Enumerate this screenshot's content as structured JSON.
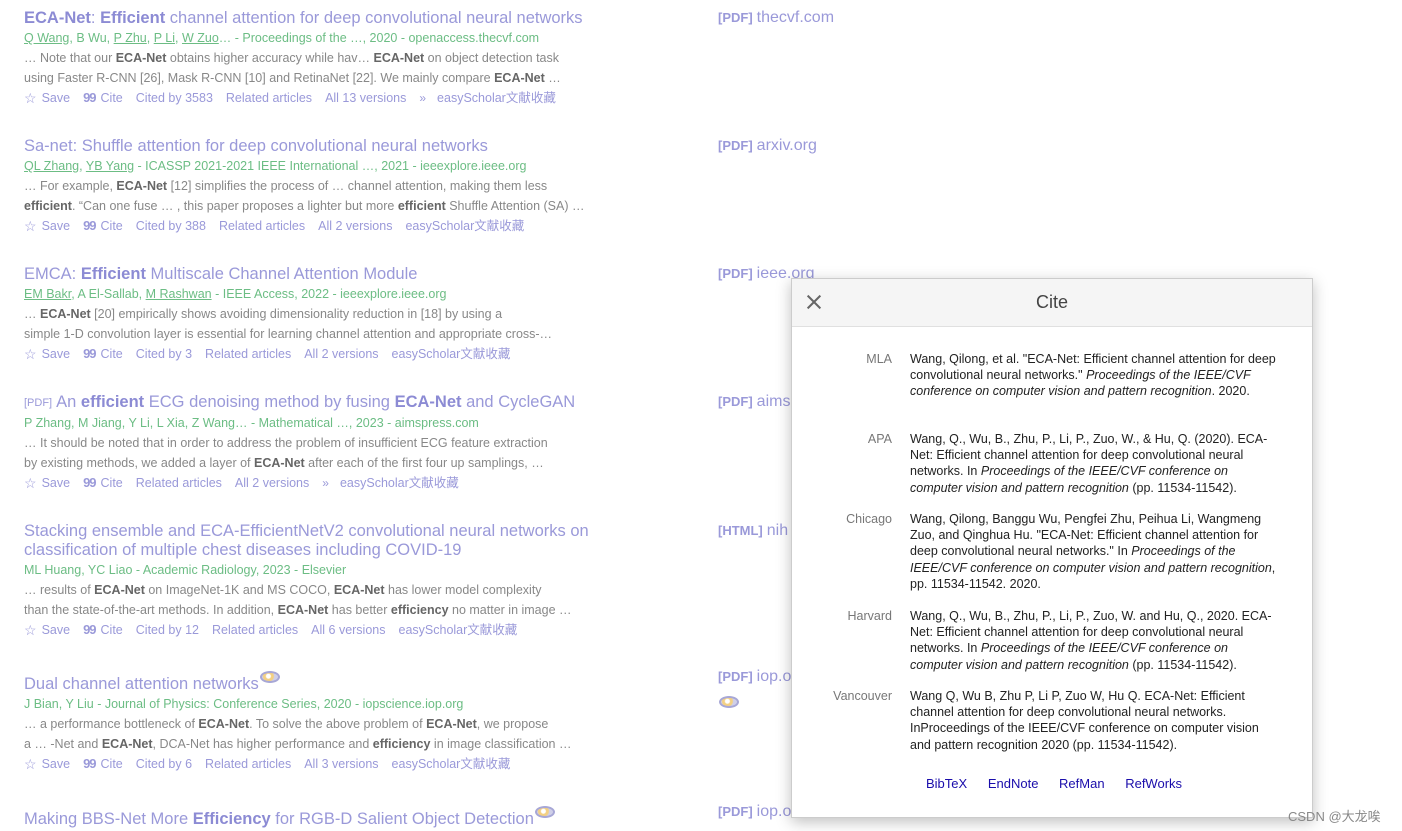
{
  "actions": {
    "save": "Save",
    "cite": "Cite",
    "related": "Related articles",
    "easyscholar": "easyScholar文献收藏"
  },
  "results": [
    {
      "title_parts": [
        [
          "ECA-Net",
          true
        ],
        [
          ": ",
          false
        ],
        [
          "Efficient",
          true
        ],
        [
          " channel attention for deep convolutional neural networks",
          false
        ]
      ],
      "authors_parts": [
        [
          "Q Wang",
          true
        ],
        [
          ", B Wu, ",
          false
        ],
        [
          "P Zhu",
          true
        ],
        [
          ", ",
          false
        ],
        [
          "P Li",
          true
        ],
        [
          ", ",
          false
        ],
        [
          "W Zuo",
          true
        ],
        [
          "… - Proceedings of the …, 2020 - openaccess.thecvf.com",
          false
        ]
      ],
      "snippet1": [
        [
          "… Note that our ",
          false
        ],
        [
          "ECA-Net",
          true
        ],
        [
          " obtains higher accuracy while hav… ",
          false
        ],
        [
          "ECA-Net",
          true
        ],
        [
          " on object detection task",
          false
        ]
      ],
      "snippet2": [
        [
          "using Faster R-CNN [26], Mask R-CNN [10] and RetinaNet [22]. We mainly compare ",
          false
        ],
        [
          "ECA-Net",
          true
        ],
        [
          " …",
          false
        ]
      ],
      "cited": "Cited by 3583",
      "versions": "All 13 versions",
      "dbl": true
    },
    {
      "title_parts": [
        [
          "Sa-net: Shuffle attention for deep convolutional neural networks",
          false
        ]
      ],
      "authors_parts": [
        [
          "QL Zhang",
          true
        ],
        [
          ", ",
          false
        ],
        [
          "YB Yang",
          true
        ],
        [
          " - ICASSP 2021-2021 IEEE International …, 2021 - ieeexplore.ieee.org",
          false
        ]
      ],
      "snippet1": [
        [
          "… For example, ",
          false
        ],
        [
          "ECA-Net",
          true
        ],
        [
          " [12] simplifies the process of … channel attention, making them less",
          false
        ]
      ],
      "snippet2": [
        [
          "efficient",
          true
        ],
        [
          ". “Can one fuse … , this paper proposes a lighter but more ",
          false
        ],
        [
          "efficient",
          true
        ],
        [
          " Shuffle Attention (SA) …",
          false
        ]
      ],
      "cited": "Cited by 388",
      "versions": "All 2 versions",
      "dbl": false
    },
    {
      "title_parts": [
        [
          "EMCA: ",
          false
        ],
        [
          "Efficient",
          true
        ],
        [
          " Multiscale Channel Attention Module",
          false
        ]
      ],
      "authors_parts": [
        [
          "EM Bakr",
          true
        ],
        [
          ", A El-Sallab, ",
          false
        ],
        [
          "M Rashwan",
          true
        ],
        [
          " - IEEE Access, 2022 - ieeexplore.ieee.org",
          false
        ]
      ],
      "snippet1": [
        [
          "… ",
          false
        ],
        [
          "ECA-Net",
          true
        ],
        [
          " [20] empirically shows avoiding dimensionality reduction in [18] by using a",
          false
        ]
      ],
      "snippet2": [
        [
          "simple 1-D convolution layer is essential for learning channel attention and appropriate cross-…",
          false
        ]
      ],
      "cited": "Cited by 3",
      "versions": "All 2 versions",
      "dbl": false
    },
    {
      "pdf": "[PDF]",
      "title_parts": [
        [
          "An ",
          false
        ],
        [
          "efficient",
          true
        ],
        [
          " ECG denoising method by fusing ",
          false
        ],
        [
          "ECA-Net",
          true
        ],
        [
          " and CycleGAN",
          false
        ]
      ],
      "authors_parts": [
        [
          "P Zhang, M Jiang, Y Li, L Xia, Z Wang… - Mathematical …, 2023 - aimspress.com",
          false
        ]
      ],
      "snippet1": [
        [
          "… It should be noted that in order to address the problem of insufficient ECG feature extraction",
          false
        ]
      ],
      "snippet2": [
        [
          "by existing methods, we added a layer of ",
          false
        ],
        [
          "ECA-Net",
          true
        ],
        [
          " after each of the first four up samplings, …",
          false
        ]
      ],
      "cited": "",
      "versions": "All 2 versions",
      "dbl": true
    },
    {
      "title_parts": [
        [
          "Stacking ensemble and ECA-EfficientNetV2 convolutional neural networks on classification of multiple chest diseases including COVID-19",
          false
        ]
      ],
      "authors_parts": [
        [
          "ML Huang, YC Liao - Academic Radiology, 2023 - Elsevier",
          false
        ]
      ],
      "snippet1": [
        [
          "… results of ",
          false
        ],
        [
          "ECA-Net",
          true
        ],
        [
          " on ImageNet-1K and MS COCO, ",
          false
        ],
        [
          "ECA-Net",
          true
        ],
        [
          " has lower model complexity",
          false
        ]
      ],
      "snippet2": [
        [
          "than the state-of-the-art methods. In addition, ",
          false
        ],
        [
          "ECA-Net",
          true
        ],
        [
          " has better ",
          false
        ],
        [
          "efficiency",
          true
        ],
        [
          " no matter in image …",
          false
        ]
      ],
      "cited": "Cited by 12",
      "versions": "All 6 versions",
      "dbl": false
    },
    {
      "title_parts": [
        [
          "Dual channel attention networks",
          false
        ]
      ],
      "globe": true,
      "authors_parts": [
        [
          "J Bian, Y Liu - Journal of Physics: Conference Series, 2020 - iopscience.iop.org",
          false
        ]
      ],
      "snippet1": [
        [
          "… a performance bottleneck of ",
          false
        ],
        [
          "ECA-Net",
          true
        ],
        [
          ". To solve the above problem of ",
          false
        ],
        [
          "ECA-Net",
          true
        ],
        [
          ", we propose",
          false
        ]
      ],
      "snippet2": [
        [
          "a … -Net and ",
          false
        ],
        [
          "ECA-Net",
          true
        ],
        [
          ", DCA-Net has higher performance and ",
          false
        ],
        [
          "efficiency",
          true
        ],
        [
          " in image classification …",
          false
        ]
      ],
      "cited": "Cited by 6",
      "versions": "All 3 versions",
      "dbl": false
    },
    {
      "title_parts": [
        [
          "Making BBS-Net More ",
          false
        ],
        [
          "Efficiency",
          true
        ],
        [
          " for RGB-D Salient Object Detection",
          false
        ]
      ],
      "globe": true
    }
  ],
  "right_links": [
    {
      "tag": "[PDF]",
      "site": "thecvf.com"
    },
    {
      "tag": "[PDF]",
      "site": "arxiv.org"
    },
    {
      "tag": "[PDF]",
      "site": "ieee.org"
    },
    {
      "tag": "[PDF]",
      "site": "aims"
    },
    {
      "tag": "[HTML]",
      "site": "nih"
    },
    {
      "tag": "[PDF]",
      "site": "iop.o"
    },
    {
      "tag": "[PDF]",
      "site": "iop.o"
    }
  ],
  "cite_dialog": {
    "title": "Cite",
    "entries": [
      {
        "label": "MLA",
        "parts": [
          [
            "Wang, Qilong, et al. \"ECA-Net: Efficient channel attention for deep convolutional neural networks.\" ",
            false
          ],
          [
            "Proceedings of the IEEE/CVF conference on computer vision and pattern recognition",
            true
          ],
          [
            ". 2020.",
            false
          ]
        ]
      },
      {
        "label": "APA",
        "parts": [
          [
            "Wang, Q., Wu, B., Zhu, P., Li, P., Zuo, W., & Hu, Q. (2020). ECA-Net: Efficient channel attention for deep convolutional neural networks. In ",
            false
          ],
          [
            "Proceedings of the IEEE/CVF conference on computer vision and pattern recognition",
            true
          ],
          [
            " (pp. 11534-11542).",
            false
          ]
        ]
      },
      {
        "label": "Chicago",
        "parts": [
          [
            "Wang, Qilong, Banggu Wu, Pengfei Zhu, Peihua Li, Wangmeng Zuo, and Qinghua Hu. \"ECA-Net: Efficient channel attention for deep convolutional neural networks.\" In ",
            false
          ],
          [
            "Proceedings of the IEEE/CVF conference on computer vision and pattern recognition",
            true
          ],
          [
            ", pp. 11534-11542. 2020.",
            false
          ]
        ]
      },
      {
        "label": "Harvard",
        "parts": [
          [
            "Wang, Q., Wu, B., Zhu, P., Li, P., Zuo, W. and Hu, Q., 2020. ECA-Net: Efficient channel attention for deep convolutional neural networks. In ",
            false
          ],
          [
            "Proceedings of the IEEE/CVF conference on computer vision and pattern recognition",
            true
          ],
          [
            " (pp. 11534-11542).",
            false
          ]
        ]
      },
      {
        "label": "Vancouver",
        "parts": [
          [
            "Wang Q, Wu B, Zhu P, Li P, Zuo W, Hu Q. ECA-Net: Efficient channel attention for deep convolutional neural networks. InProceedings of the IEEE/CVF conference on computer vision and pattern recognition 2020 (pp. 11534-11542).",
            false
          ]
        ]
      }
    ],
    "formats": [
      "BibTeX",
      "EndNote",
      "RefMan",
      "RefWorks"
    ]
  },
  "watermark": "CSDN @大龙唉"
}
